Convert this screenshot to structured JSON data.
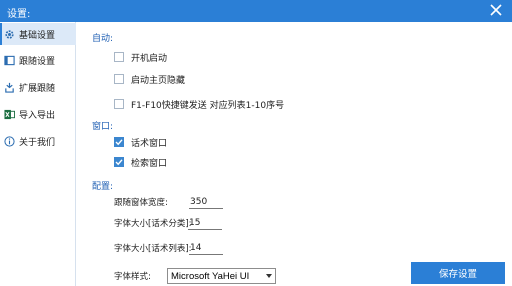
{
  "window": {
    "title": "设置:"
  },
  "sidebar": {
    "items": [
      {
        "label": "基础设置",
        "icon": "gear-icon",
        "active": true
      },
      {
        "label": "跟随设置",
        "icon": "follow-window-icon",
        "active": false
      },
      {
        "label": "扩展跟随",
        "icon": "extension-icon",
        "active": false
      },
      {
        "label": "导入导出",
        "icon": "excel-icon",
        "active": false
      },
      {
        "label": "关于我们",
        "icon": "info-icon",
        "active": false
      }
    ]
  },
  "sections": {
    "auto": "自动:",
    "window": "窗口:",
    "config": "配置:"
  },
  "options": {
    "autostart": {
      "label": "开机启动",
      "checked": false
    },
    "hide_main": {
      "label": "启动主页隐藏",
      "checked": false
    },
    "f1_f10": {
      "label": "F1-F10快捷键发送 对应列表1-10序号",
      "checked": false
    },
    "speech_window": {
      "label": "话术窗口",
      "checked": true
    },
    "search_window": {
      "label": "检索窗口",
      "checked": true
    }
  },
  "fields": {
    "follow_width": {
      "label": "跟随窗体宽度:",
      "value": "350"
    },
    "font_category": {
      "label": "字体大小[话术分类]:",
      "value": "15"
    },
    "font_list": {
      "label": "字体大小[话术列表]:",
      "value": "14"
    },
    "font_style": {
      "label": "字体样式:",
      "value": "Microsoft YaHei UI"
    }
  },
  "buttons": {
    "save": "保存设置"
  },
  "colors": {
    "accent": "#2b7fd6",
    "section": "#1f5fb3",
    "active_bg": "#dce9f8"
  }
}
